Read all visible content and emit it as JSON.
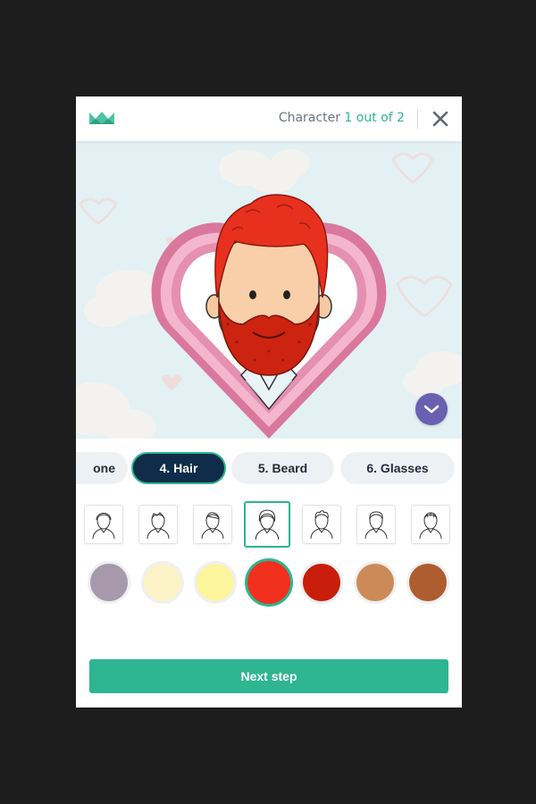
{
  "header": {
    "step_label": "Character",
    "step_progress": "1 out of 2",
    "logo_icon": "crown-logo-icon",
    "close_icon": "close-icon"
  },
  "preview": {
    "collapse_icon": "chevron-down-icon"
  },
  "tabs": [
    {
      "label": "one",
      "active": false
    },
    {
      "label": "4. Hair",
      "active": true
    },
    {
      "label": "5. Beard",
      "active": false
    },
    {
      "label": "6. Glasses",
      "active": false
    }
  ],
  "hair_styles": [
    {
      "icon": "hairstyle-1-icon",
      "selected": false
    },
    {
      "icon": "hairstyle-2-icon",
      "selected": false
    },
    {
      "icon": "hairstyle-3-icon",
      "selected": false
    },
    {
      "icon": "hairstyle-4-icon",
      "selected": true
    },
    {
      "icon": "hairstyle-5-icon",
      "selected": false
    },
    {
      "icon": "hairstyle-6-icon",
      "selected": false
    },
    {
      "icon": "hairstyle-7-icon",
      "selected": false
    }
  ],
  "hair_colors": [
    {
      "hex": "#a898ac",
      "selected": false
    },
    {
      "hex": "#fbf3c6",
      "selected": false
    },
    {
      "hex": "#fdf59c",
      "selected": false
    },
    {
      "hex": "#f2301e",
      "selected": true
    },
    {
      "hex": "#c81e0b",
      "selected": false
    },
    {
      "hex": "#cc8a58",
      "selected": false
    },
    {
      "hex": "#ae5d30",
      "selected": false
    }
  ],
  "footer": {
    "next_label": "Next step"
  },
  "colors": {
    "accent": "#2eb591",
    "navy": "#0f2c4a",
    "purple": "#6a5fb0"
  }
}
